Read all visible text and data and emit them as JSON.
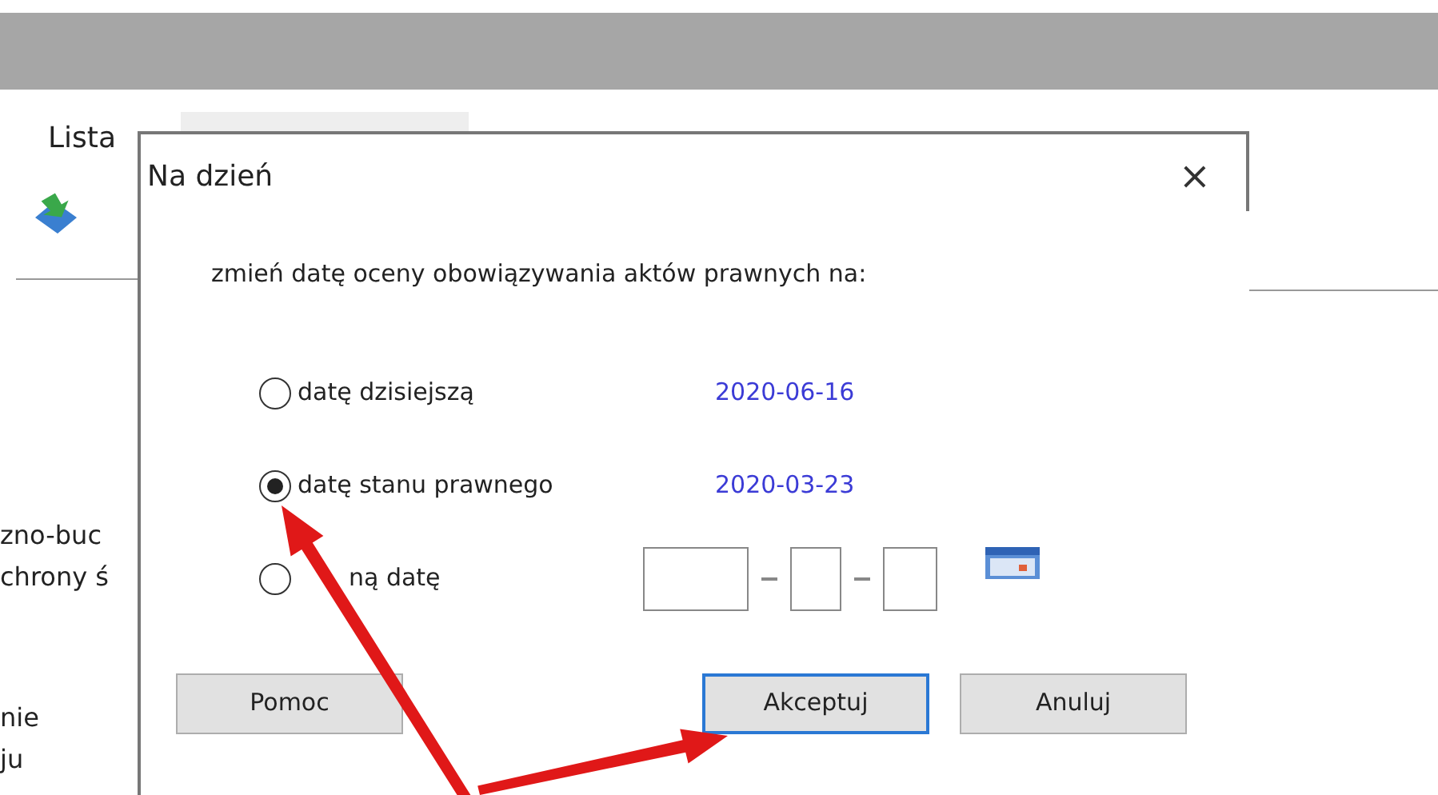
{
  "background_window": {
    "tab": "Lista",
    "side_texts": [
      "zno-buc",
      "chrony ś",
      "nie",
      "ju"
    ]
  },
  "dialog": {
    "title": "Na dzień",
    "close": "×",
    "prompt": "zmień datę oceny obowiązywania aktów prawnych na:",
    "options": [
      {
        "kind": "date",
        "label": "datę dzisiejszą",
        "selected": false,
        "value": "2020-06-16"
      },
      {
        "kind": "date",
        "label": "datę stanu prawnego",
        "selected": true,
        "value": "2020-03-23"
      },
      {
        "kind": "input",
        "label": "ną datę",
        "selected": false
      }
    ],
    "buttons": [
      {
        "label": "Pomoc",
        "focused": false
      },
      {
        "label": "Akceptuj",
        "focused": true
      },
      {
        "label": "Anuluj",
        "focused": false
      }
    ]
  }
}
